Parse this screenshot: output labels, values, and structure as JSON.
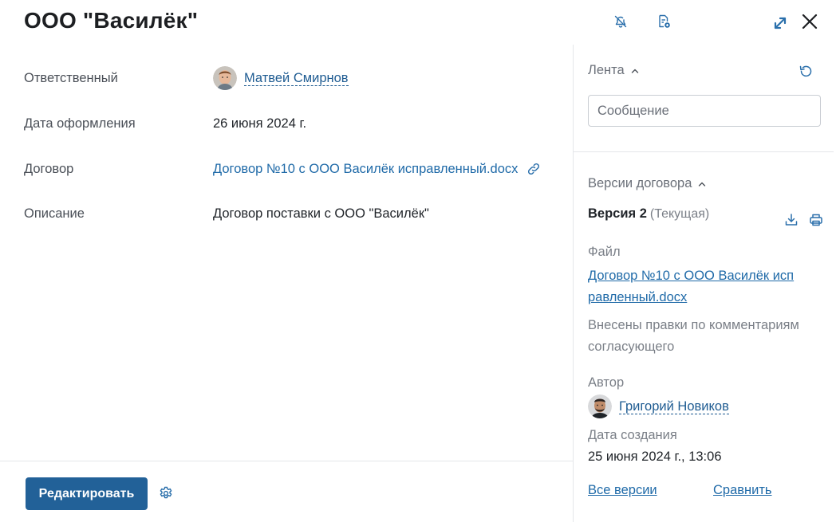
{
  "header": {
    "title": "ООО \"Василёк\"",
    "icons": [
      "bell-off-icon",
      "document-settings-icon",
      "expand-icon",
      "close-icon"
    ]
  },
  "fields": [
    {
      "label": "Ответственный",
      "value": "Матвей Смирнов",
      "kind": "user"
    },
    {
      "label": "Дата оформления",
      "value": "26 июня 2024 г.",
      "kind": "text"
    },
    {
      "label": "Договор",
      "value": "Договор №10 с ООО Василёк исправленный.docx",
      "kind": "file"
    },
    {
      "label": "Описание",
      "value": "Договор поставки с ООО \"Василёк\"",
      "kind": "text"
    }
  ],
  "feed": {
    "title": "Лента",
    "message_placeholder": "Сообщение"
  },
  "versions": {
    "title": "Версии договора",
    "current_version": "Версия 2",
    "current_badge": "(Текущая)",
    "file_label": "Файл",
    "file_name_line1": "Договор №10 с ООО Василёк исп",
    "file_name_line2": "равленный.docx",
    "comment_line1": "Внесены правки по комментариям",
    "comment_line2": "согласующего",
    "author_label": "Автор",
    "author_name": "Григорий Новиков",
    "created_label": "Дата создания",
    "created_value": "25 июня 2024 г., 13:06",
    "all_versions_link": "Все версии",
    "compare_link": "Сравнить"
  },
  "footer": {
    "edit_button": "Редактировать"
  },
  "colors": {
    "accent": "#226198",
    "link": "#1f6aa8",
    "icon": "#2a6fab",
    "text": "#1f2328",
    "muted": "#7a7f87",
    "divider": "#e4e6ea"
  }
}
